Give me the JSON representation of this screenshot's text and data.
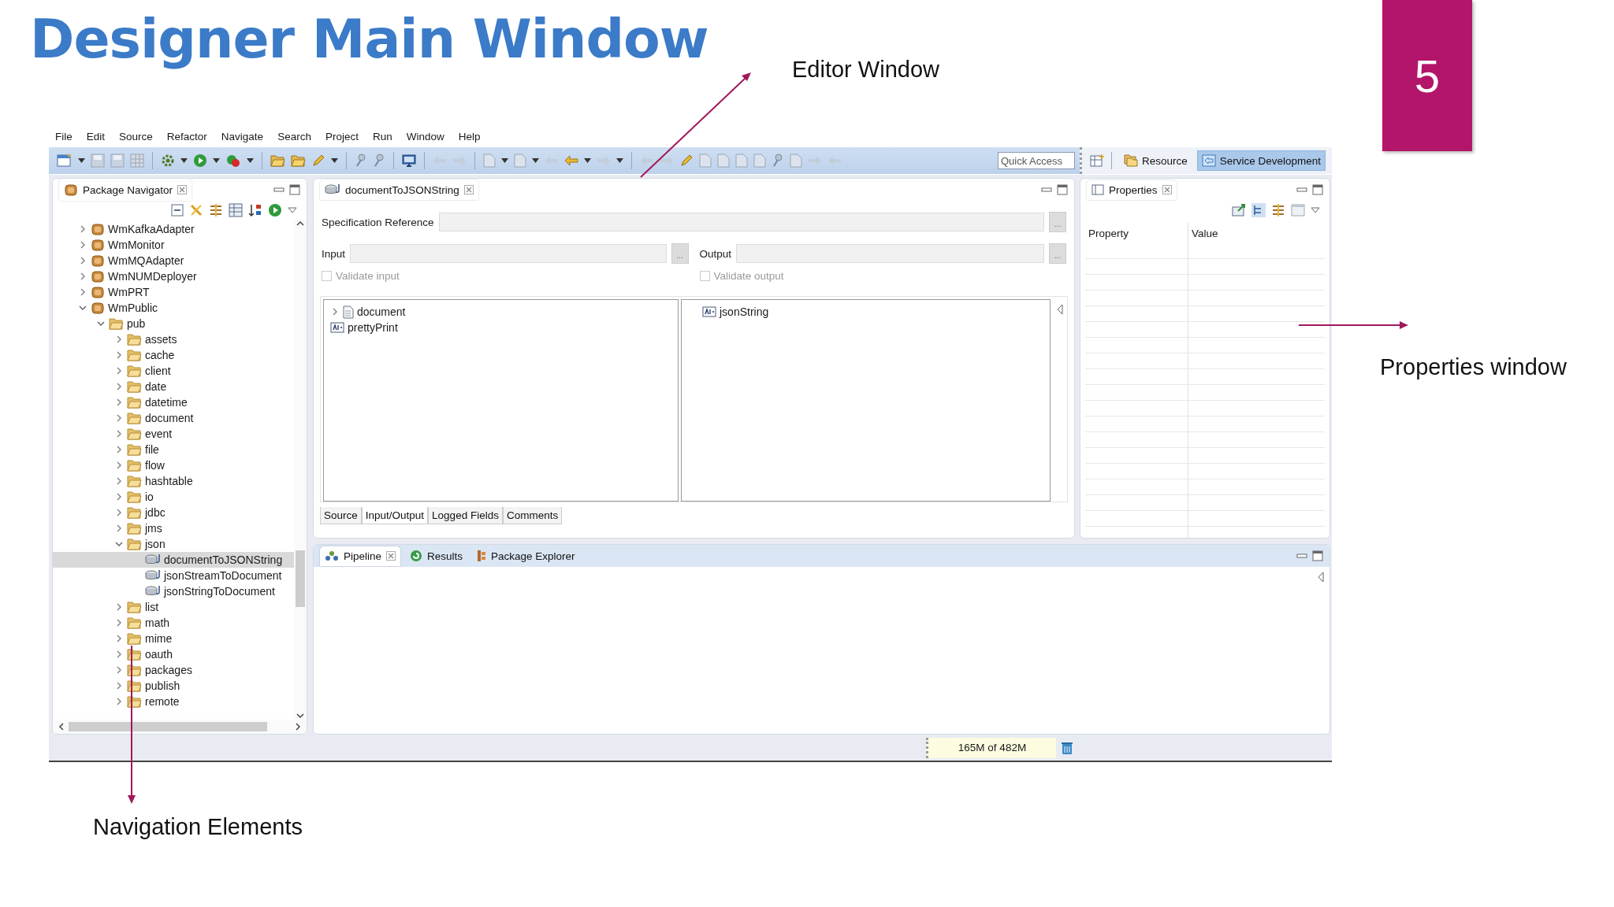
{
  "slide": {
    "title": "Designer Main Window",
    "number": "5",
    "callouts": [
      {
        "kind": "editor",
        "text": "Editor Window"
      },
      {
        "kind": "properties",
        "text": "Properties window"
      },
      {
        "kind": "navigation",
        "text": "Navigation Elements"
      }
    ]
  },
  "menu": [
    "File",
    "Edit",
    "Source",
    "Refactor",
    "Navigate",
    "Search",
    "Project",
    "Run",
    "Window",
    "Help"
  ],
  "toolbar": {
    "quick_access": {
      "placeholder": "Quick Access"
    },
    "perspectives": [
      {
        "label": "Resource",
        "selected": false
      },
      {
        "label": "Service Development",
        "selected": true
      }
    ]
  },
  "navigator": {
    "title": "Package Navigator",
    "tree": [
      {
        "name": "WmKafkaAdapter",
        "kind": "package",
        "expanded": false,
        "selected": false
      },
      {
        "name": "WmMonitor",
        "kind": "package",
        "expanded": false,
        "selected": false
      },
      {
        "name": "WmMQAdapter",
        "kind": "package",
        "expanded": false,
        "selected": false
      },
      {
        "name": "WmNUMDeployer",
        "kind": "package",
        "expanded": false,
        "selected": false
      },
      {
        "name": "WmPRT",
        "kind": "package",
        "expanded": false,
        "selected": false
      },
      {
        "name": "WmPublic",
        "kind": "package",
        "expanded": true,
        "selected": false,
        "children": [
          {
            "name": "pub",
            "kind": "folder",
            "expanded": true,
            "selected": false,
            "children": [
              {
                "name": "assets",
                "kind": "folder",
                "expanded": false,
                "selected": false
              },
              {
                "name": "cache",
                "kind": "folder",
                "expanded": false,
                "selected": false
              },
              {
                "name": "client",
                "kind": "folder",
                "expanded": false,
                "selected": false
              },
              {
                "name": "date",
                "kind": "folder",
                "expanded": false,
                "selected": false
              },
              {
                "name": "datetime",
                "kind": "folder",
                "expanded": false,
                "selected": false
              },
              {
                "name": "document",
                "kind": "folder",
                "expanded": false,
                "selected": false
              },
              {
                "name": "event",
                "kind": "folder",
                "expanded": false,
                "selected": false
              },
              {
                "name": "file",
                "kind": "folder",
                "expanded": false,
                "selected": false
              },
              {
                "name": "flow",
                "kind": "folder",
                "expanded": false,
                "selected": false
              },
              {
                "name": "hashtable",
                "kind": "folder",
                "expanded": false,
                "selected": false
              },
              {
                "name": "io",
                "kind": "folder",
                "expanded": false,
                "selected": false
              },
              {
                "name": "jdbc",
                "kind": "folder",
                "expanded": false,
                "selected": false
              },
              {
                "name": "jms",
                "kind": "folder",
                "expanded": false,
                "selected": false
              },
              {
                "name": "json",
                "kind": "folder",
                "expanded": true,
                "selected": false,
                "children": [
                  {
                    "name": "documentToJSONString",
                    "kind": "service",
                    "selected": true
                  },
                  {
                    "name": "jsonStreamToDocument",
                    "kind": "service",
                    "selected": false
                  },
                  {
                    "name": "jsonStringToDocument",
                    "kind": "service",
                    "selected": false
                  }
                ]
              },
              {
                "name": "list",
                "kind": "folder",
                "expanded": false,
                "selected": false
              },
              {
                "name": "math",
                "kind": "folder",
                "expanded": false,
                "selected": false
              },
              {
                "name": "mime",
                "kind": "folder",
                "expanded": false,
                "selected": false
              },
              {
                "name": "oauth",
                "kind": "folder",
                "expanded": false,
                "selected": false
              },
              {
                "name": "packages",
                "kind": "folder",
                "expanded": false,
                "selected": false
              },
              {
                "name": "publish",
                "kind": "folder",
                "expanded": false,
                "selected": false
              },
              {
                "name": "remote",
                "kind": "folder",
                "expanded": false,
                "selected": false
              }
            ]
          }
        ]
      }
    ]
  },
  "editor": {
    "tab": "documentToJSONString",
    "spec_reference": {
      "label": "Specification Reference",
      "button": "..."
    },
    "input": {
      "label": "Input",
      "button": "..."
    },
    "output": {
      "label": "Output",
      "button": "..."
    },
    "validate_input": {
      "label": "Validate input",
      "checked": false,
      "disabled": true
    },
    "validate_output": {
      "label": "Validate output",
      "checked": false,
      "disabled": true
    },
    "input_tree": [
      {
        "name": "document",
        "kind": "document",
        "expanded": false
      },
      {
        "name": "prettyPrint",
        "kind": "string"
      }
    ],
    "output_tree": [
      {
        "name": "jsonString",
        "kind": "string"
      }
    ],
    "tabs": [
      {
        "label": "Source",
        "selected": false
      },
      {
        "label": "Input/Output",
        "selected": true
      },
      {
        "label": "Logged Fields",
        "selected": false
      },
      {
        "label": "Comments",
        "selected": false
      }
    ]
  },
  "properties": {
    "title": "Properties",
    "columns": [
      "Property",
      "Value"
    ]
  },
  "bottom_panel": {
    "tabs": [
      {
        "label": "Pipeline",
        "kind": "pipeline",
        "selected": true
      },
      {
        "label": "Results",
        "kind": "results",
        "selected": false
      },
      {
        "label": "Package Explorer",
        "kind": "explorer",
        "selected": false
      }
    ]
  },
  "status_bar": {
    "memory": "165M of 482M"
  }
}
